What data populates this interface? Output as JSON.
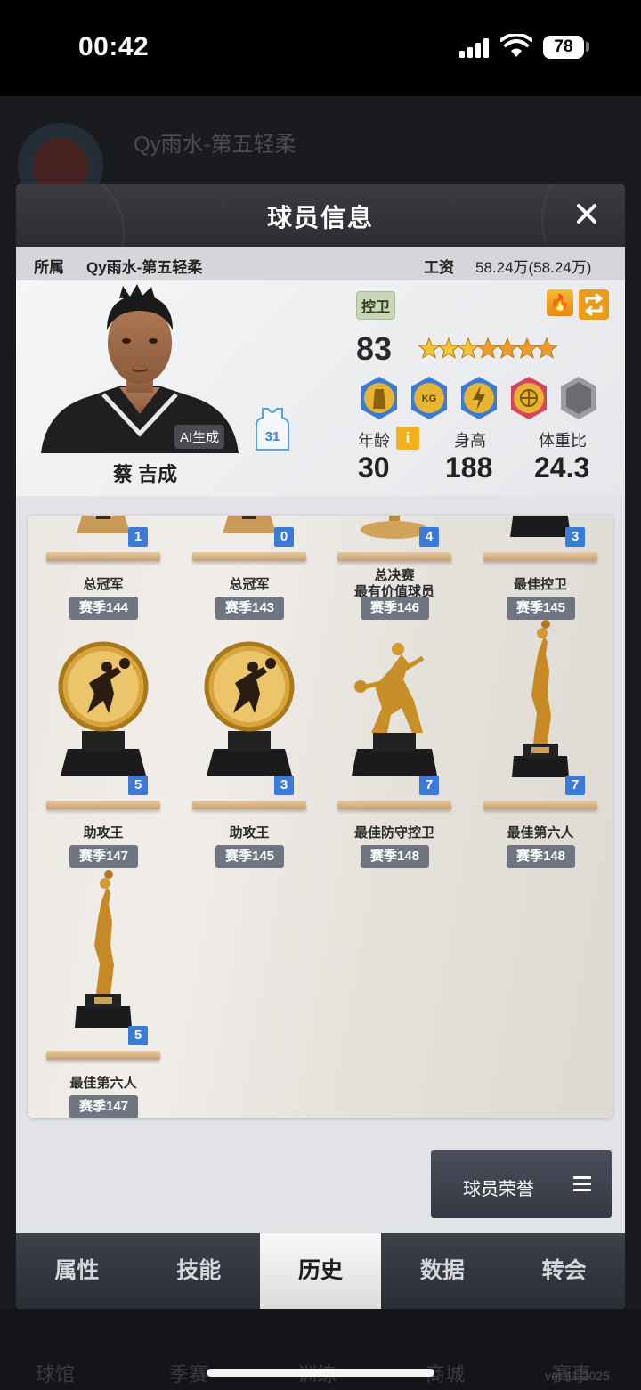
{
  "status_bar": {
    "time": "00:42",
    "battery": "78"
  },
  "modal": {
    "title": "球员信息",
    "affiliation_label": "所属",
    "affiliation_value": "Qy雨水-第五轻柔",
    "salary_label": "工资",
    "salary_value": "58.24万(58.24万)"
  },
  "player": {
    "name": "蔡 吉成",
    "ai_tag": "AI生成",
    "jersey_number": "31",
    "position": "控卫",
    "rating": "83",
    "stars": {
      "filled": 3,
      "total": 7
    },
    "badges": [
      "stamina-badge-icon",
      "kg-badge-icon",
      "speed-badge-icon",
      "ball-badge-icon",
      "locked-badge-icon"
    ],
    "stats": [
      {
        "label": "年龄",
        "value": "30"
      },
      {
        "label": "身高",
        "value": "188"
      },
      {
        "label": "体重比",
        "value": "24.3"
      }
    ]
  },
  "trophies": [
    {
      "name": "总冠军",
      "count": "1",
      "season": "赛季144",
      "icon": "championship-trophy-icon"
    },
    {
      "name": "总冠军",
      "count": "0",
      "season": "赛季143",
      "icon": "championship-trophy-icon"
    },
    {
      "name": "总决赛\n最有价值球员",
      "count": "4",
      "season": "赛季146",
      "icon": "finals-mvp-trophy-icon"
    },
    {
      "name": "最佳控卫",
      "count": "3",
      "season": "赛季145",
      "icon": "best-pg-trophy-icon"
    },
    {
      "name": "助攻王",
      "count": "5",
      "season": "赛季147",
      "icon": "assist-leader-trophy-icon"
    },
    {
      "name": "助攻王",
      "count": "3",
      "season": "赛季145",
      "icon": "assist-leader-trophy-icon"
    },
    {
      "name": "最佳防守控卫",
      "count": "7",
      "season": "赛季148",
      "icon": "best-defensive-pg-trophy-icon"
    },
    {
      "name": "最佳第六人",
      "count": "7",
      "season": "赛季148",
      "icon": "sixth-man-trophy-icon"
    },
    {
      "name": "最佳第六人",
      "count": "5",
      "season": "赛季147",
      "icon": "sixth-man-trophy-icon"
    }
  ],
  "honor_button": "球员荣誉",
  "tabs": [
    "属性",
    "技能",
    "历史",
    "数据",
    "转会"
  ],
  "active_tab": "历史",
  "background": {
    "team_name": "Qy雨水-第五轻柔",
    "bottom_labels": [
      "球馆",
      "季赛",
      "训练",
      "商城",
      "赛事"
    ],
    "version": "ver:11  2025"
  },
  "colors": {
    "accent_orange": "#f0a020",
    "count_blue": "#3b7ad6",
    "season_gray": "#6f7681"
  }
}
